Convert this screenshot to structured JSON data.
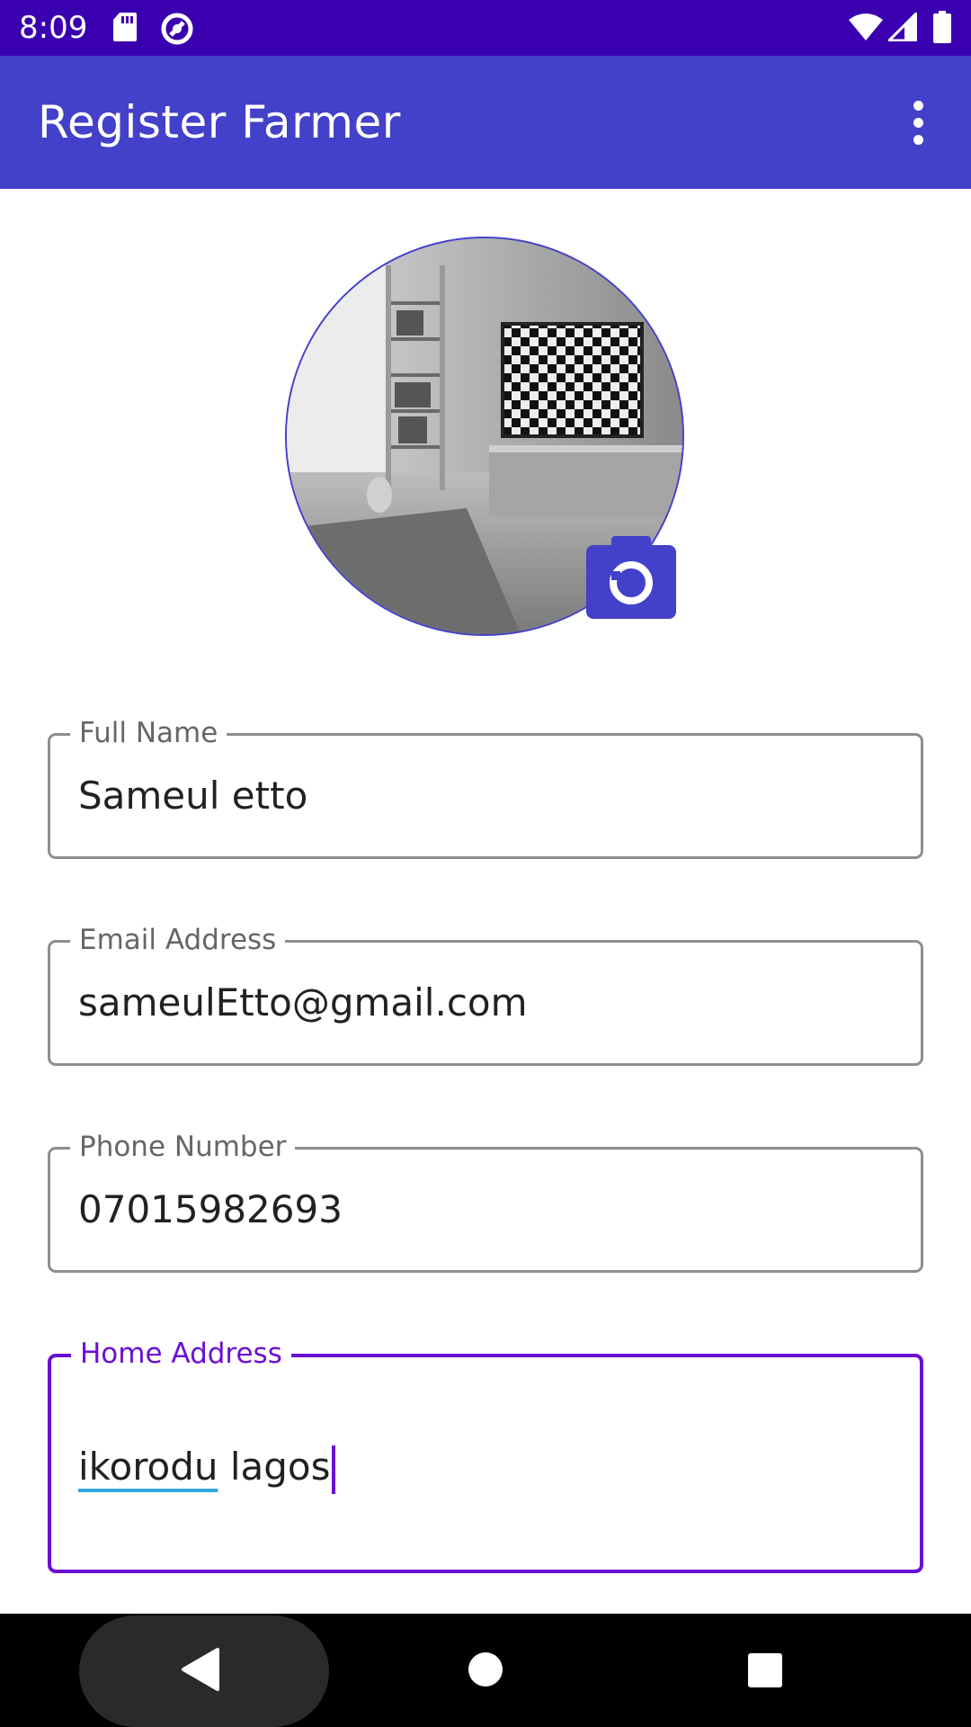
{
  "status_bar": {
    "time": "8:09",
    "left_icons": [
      "sd-card-icon",
      "data-saver-icon"
    ],
    "right_icons": [
      "wifi-icon",
      "signal-icon",
      "battery-icon"
    ]
  },
  "app_bar": {
    "title": "Register Farmer",
    "menu_icon": "more-vert-icon"
  },
  "profile": {
    "avatar_description": "profile photo",
    "camera_icon": "camera-icon"
  },
  "form": {
    "full_name": {
      "label": "Full Name",
      "value": "Sameul etto"
    },
    "email": {
      "label": "Email Address",
      "value": "sameulEtto@gmail.com"
    },
    "phone": {
      "label": "Phone Number",
      "value": "07015982693"
    },
    "home_address": {
      "label": "Home Address",
      "value_part1": "ikorodu",
      "value_part2": " lagos"
    }
  },
  "nav_bar": {
    "back_icon": "back-icon",
    "home_icon": "home-icon",
    "recents_icon": "recents-icon"
  },
  "colors": {
    "status_bar": "#3a00b0",
    "app_bar": "#4340c9",
    "focused_field": "#6a0fd6",
    "field_border": "#8e8e8e"
  }
}
